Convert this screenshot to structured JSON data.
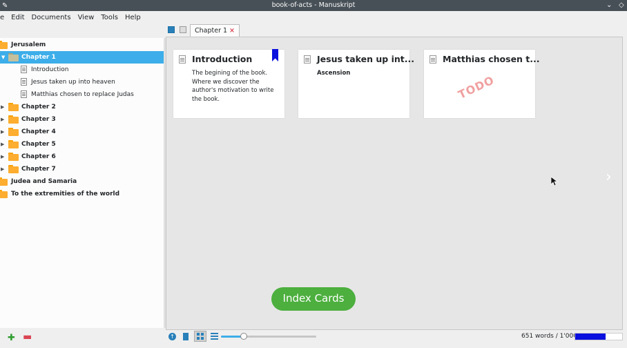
{
  "window": {
    "title": "book-of-acts - Manuskript"
  },
  "menu": {
    "items": [
      "e",
      "Edit",
      "Documents",
      "View",
      "Tools",
      "Help"
    ]
  },
  "tree": {
    "items": [
      {
        "label": "Jerusalem",
        "type": "folder"
      },
      {
        "label": "Chapter 1",
        "type": "folder",
        "selected": true
      },
      {
        "label": "Introduction",
        "type": "doc"
      },
      {
        "label": "Jesus taken up into heaven",
        "type": "doc"
      },
      {
        "label": "Matthias chosen to replace Judas",
        "type": "doc"
      },
      {
        "label": "Chapter 2",
        "type": "folder"
      },
      {
        "label": "Chapter 3",
        "type": "folder"
      },
      {
        "label": "Chapter 4",
        "type": "folder"
      },
      {
        "label": "Chapter 5",
        "type": "folder"
      },
      {
        "label": "Chapter 6",
        "type": "folder"
      },
      {
        "label": "Chapter 7",
        "type": "folder"
      },
      {
        "label": "Judea and Samaria",
        "type": "folder"
      },
      {
        "label": "To the extremities of the world",
        "type": "folder"
      }
    ]
  },
  "tabs": {
    "active": "Chapter 1",
    "close": "×"
  },
  "cards": [
    {
      "title": "Introduction",
      "summary": "The begining of the book. Where we discover the author's motivation to write the book.",
      "bookmark_color": "#0a10dd"
    },
    {
      "title": "Jesus taken up int...",
      "label": "Ascension"
    },
    {
      "title": "Matthias chosen t...",
      "stamp": "TODO"
    }
  ],
  "overlay": {
    "label": "Index Cards"
  },
  "status": {
    "wordcount": "651 words / 1'000",
    "progress_fraction": 0.651,
    "zoom_slider_fraction": 0.24
  },
  "colors": {
    "accent": "#3daee9",
    "progress": "#0a10dd",
    "overlay": "#4caf3e"
  }
}
